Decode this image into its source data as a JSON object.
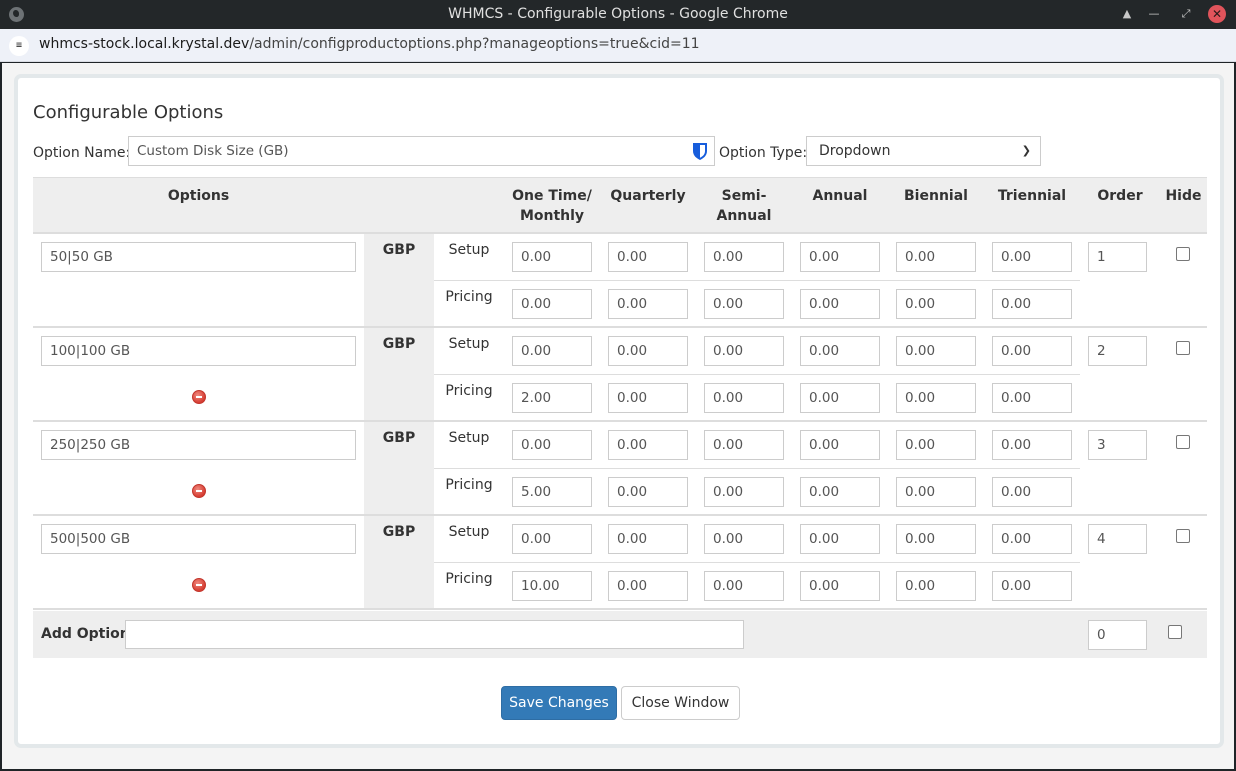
{
  "window": {
    "title": "WHMCS - Configurable Options - Google Chrome",
    "controls": [
      "shade",
      "minimize",
      "maximize",
      "close"
    ]
  },
  "addressbar": {
    "url_host": "whmcs-stock.local.krystal.dev",
    "url_path": "/admin/configproductoptions.php?manageoptions=true&cid=11"
  },
  "page": {
    "heading": "Configurable Options",
    "option_name_label": "Option Name:",
    "option_name_value": "Custom Disk Size (GB)",
    "option_type_label": "Option Type:",
    "option_type_value": "Dropdown"
  },
  "table": {
    "headers": {
      "options": "Options",
      "monthly_1": "One Time/",
      "monthly_2": "Monthly",
      "quarterly": "Quarterly",
      "semi_1": "Semi-",
      "semi_2": "Annual",
      "annual": "Annual",
      "biennial": "Biennial",
      "triennial": "Triennial",
      "order": "Order",
      "hide": "Hide"
    },
    "currency": "GBP",
    "setup_label": "Setup",
    "pricing_label": "Pricing",
    "rows": [
      {
        "name": "50|50 GB",
        "removable": false,
        "setup": [
          "0.00",
          "0.00",
          "0.00",
          "0.00",
          "0.00",
          "0.00"
        ],
        "pricing": [
          "0.00",
          "0.00",
          "0.00",
          "0.00",
          "0.00",
          "0.00"
        ],
        "order": "1",
        "hide": false
      },
      {
        "name": "100|100 GB",
        "removable": true,
        "setup": [
          "0.00",
          "0.00",
          "0.00",
          "0.00",
          "0.00",
          "0.00"
        ],
        "pricing": [
          "2.00",
          "0.00",
          "0.00",
          "0.00",
          "0.00",
          "0.00"
        ],
        "order": "2",
        "hide": false
      },
      {
        "name": "250|250 GB",
        "removable": true,
        "setup": [
          "0.00",
          "0.00",
          "0.00",
          "0.00",
          "0.00",
          "0.00"
        ],
        "pricing": [
          "5.00",
          "0.00",
          "0.00",
          "0.00",
          "0.00",
          "0.00"
        ],
        "order": "3",
        "hide": false
      },
      {
        "name": "500|500 GB",
        "removable": true,
        "setup": [
          "0.00",
          "0.00",
          "0.00",
          "0.00",
          "0.00",
          "0.00"
        ],
        "pricing": [
          "10.00",
          "0.00",
          "0.00",
          "0.00",
          "0.00",
          "0.00"
        ],
        "order": "4",
        "hide": false
      }
    ],
    "add_option": {
      "label": "Add Option:",
      "value": "",
      "order": "0",
      "hide": false
    }
  },
  "buttons": {
    "save": "Save Changes",
    "close": "Close Window"
  },
  "colors": {
    "primary": "#337ab7",
    "close_button": "#e0545b",
    "remove_icon": "#d63d32",
    "bitwarden": "#175ddc"
  }
}
